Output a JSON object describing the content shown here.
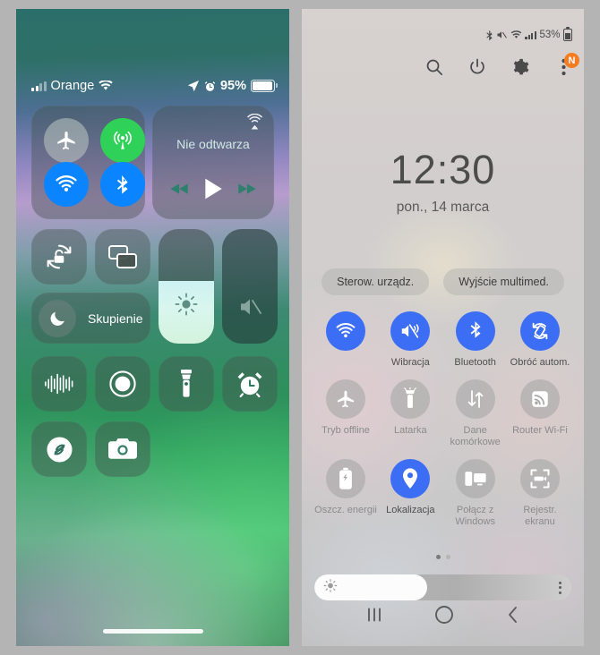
{
  "ios": {
    "status": {
      "signal_icon": "signal-bars-icon",
      "carrier": "Orange",
      "wifi_icon": "wifi-icon",
      "location_icon": "location-arrow-icon",
      "alarm_icon": "alarm-clock-icon",
      "battery_percent": "95%",
      "battery_icon": "battery-icon"
    },
    "connectivity": {
      "airplane": {
        "name": "airplane-mode-toggle",
        "icon": "airplane-icon",
        "state": "off",
        "color": "#bec8c3"
      },
      "cellular": {
        "name": "cellular-data-toggle",
        "icon": "cellular-antenna-icon",
        "state": "on",
        "color": "#30d158"
      },
      "wifi": {
        "name": "wifi-toggle",
        "icon": "wifi-icon",
        "state": "on",
        "color": "#0a84ff"
      },
      "bluetooth": {
        "name": "bluetooth-toggle",
        "icon": "bluetooth-icon",
        "state": "on",
        "color": "#0a84ff"
      }
    },
    "media": {
      "title": "Nie odtwarza",
      "airplay_icon": "airplay-icon",
      "prev_icon": "rewind-icon",
      "play_icon": "play-icon",
      "next_icon": "fast-forward-icon"
    },
    "tiles": {
      "rotation_lock": {
        "label": "",
        "icon": "rotation-lock-icon"
      },
      "screen_mirroring": {
        "label": "",
        "icon": "screen-mirroring-icon"
      },
      "focus": {
        "label": "Skupienie",
        "icon": "moon-icon"
      },
      "voice_memo": {
        "label": "",
        "icon": "voice-memo-waveform-icon"
      },
      "screen_record": {
        "label": "",
        "icon": "screen-record-icon"
      },
      "flashlight": {
        "label": "",
        "icon": "flashlight-icon"
      },
      "alarm": {
        "label": "",
        "icon": "alarm-clock-icon"
      },
      "shazam": {
        "label": "",
        "icon": "shazam-icon"
      },
      "camera": {
        "label": "",
        "icon": "camera-icon"
      }
    },
    "sliders": {
      "brightness": {
        "name": "brightness-slider",
        "icon": "sun-icon",
        "value": 55
      },
      "volume": {
        "name": "volume-slider",
        "icon": "speaker-mute-icon",
        "value": 0
      }
    },
    "home_indicator": "home-indicator"
  },
  "samsung": {
    "status": {
      "bluetooth_icon": "bluetooth-icon",
      "mute_icon": "mute-icon",
      "wifi_icon": "wifi-icon",
      "signal_icon": "signal-bars-icon",
      "battery_percent": "53%",
      "battery_icon": "battery-icon"
    },
    "actions": [
      {
        "name": "search-button",
        "icon": "search-icon"
      },
      {
        "name": "power-button",
        "icon": "power-icon"
      },
      {
        "name": "settings-button",
        "icon": "gear-icon"
      },
      {
        "name": "overflow-menu-button",
        "icon": "kebab-menu-icon",
        "badge": "N",
        "badge_color": "#f57c20"
      }
    ],
    "clock": "12:30",
    "date": "pon., 14 marca",
    "pills": [
      {
        "name": "device-control-pill",
        "label": "Sterow. urządz."
      },
      {
        "name": "media-output-pill",
        "label": "Wyjście multimed."
      }
    ],
    "quick_toggles": [
      [
        {
          "name": "wifi-toggle",
          "label": "",
          "icon": "wifi-icon",
          "state": "on"
        },
        {
          "name": "vibrate-toggle",
          "label": "Wibracja",
          "icon": "vibrate-icon",
          "state": "on"
        },
        {
          "name": "bluetooth-toggle",
          "label": "Bluetooth",
          "icon": "bluetooth-icon",
          "state": "on"
        },
        {
          "name": "auto-rotate-toggle",
          "label": "Obróć autom.",
          "icon": "auto-rotate-icon",
          "state": "on"
        }
      ],
      [
        {
          "name": "airplane-mode-toggle",
          "label": "Tryb offline",
          "icon": "airplane-icon",
          "state": "off"
        },
        {
          "name": "flashlight-toggle",
          "label": "Latarka",
          "icon": "flashlight-icon",
          "state": "off"
        },
        {
          "name": "mobile-data-toggle",
          "label": "Dane komórkowe",
          "icon": "data-transfer-icon",
          "state": "off"
        },
        {
          "name": "wifi-hotspot-toggle",
          "label": "Router Wi-Fi",
          "icon": "hotspot-icon",
          "state": "off"
        }
      ],
      [
        {
          "name": "power-saving-toggle",
          "label": "Oszcz. energii",
          "icon": "battery-saver-icon",
          "state": "off"
        },
        {
          "name": "location-toggle",
          "label": "Lokalizacja",
          "icon": "location-pin-icon",
          "state": "on"
        },
        {
          "name": "link-to-windows-toggle",
          "label": "Połącz z Windows",
          "icon": "link-to-windows-icon",
          "state": "off"
        },
        {
          "name": "screen-recorder-toggle",
          "label": "Rejestr. ekranu",
          "icon": "screen-recorder-icon",
          "state": "off"
        }
      ]
    ],
    "page_dots": {
      "count": 2,
      "active": 0
    },
    "brightness": {
      "name": "brightness-slider",
      "value": 44,
      "icon": "sun-icon",
      "menu_icon": "kebab-menu-icon"
    },
    "navbar": [
      {
        "name": "recents-button",
        "icon": "recents-icon"
      },
      {
        "name": "home-button",
        "icon": "home-icon"
      },
      {
        "name": "back-button",
        "icon": "back-icon"
      }
    ],
    "colors": {
      "accent": "#3b6ef5",
      "badge": "#f57c20"
    }
  }
}
